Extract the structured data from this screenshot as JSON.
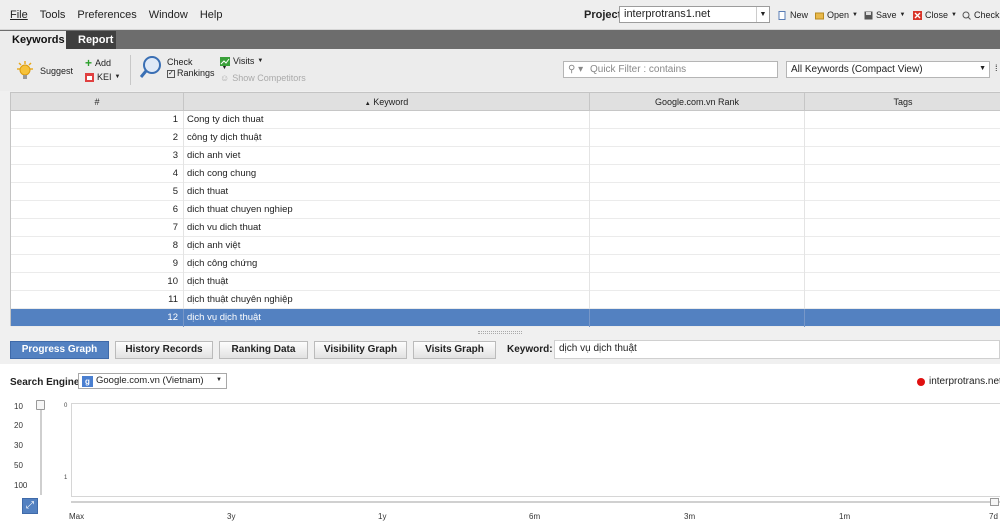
{
  "menu": {
    "items": [
      "File",
      "Tools",
      "Preferences",
      "Window",
      "Help"
    ],
    "project_label": "Project:",
    "project_value": "interprotrans1.net",
    "actions": {
      "new": "New",
      "open": "Open",
      "save": "Save",
      "close": "Close",
      "check": "Check"
    }
  },
  "tabs": {
    "keywords": "Keywords",
    "report": "Report"
  },
  "toolbar": {
    "suggest": "Suggest",
    "add": "Add",
    "kei": "KEI",
    "check": "Check",
    "rankings": "Rankings",
    "visits": "Visits",
    "show_competitors": "Show Competitors",
    "filter_placeholder": "Quick Filter : contains",
    "view_select": "All Keywords (Compact View)"
  },
  "table": {
    "headers": {
      "num": "#",
      "keyword": "Keyword",
      "rank": "Google.com.vn Rank",
      "tags": "Tags"
    },
    "sort_indicator": "▲",
    "rows": [
      {
        "num": "1",
        "keyword": "Cong ty dich thuat"
      },
      {
        "num": "2",
        "keyword": "công ty dịch thuật"
      },
      {
        "num": "3",
        "keyword": "dich anh viet"
      },
      {
        "num": "4",
        "keyword": "dich cong chung"
      },
      {
        "num": "5",
        "keyword": "dich thuat"
      },
      {
        "num": "6",
        "keyword": "dich thuat chuyen nghiep"
      },
      {
        "num": "7",
        "keyword": "dich vu dich thuat"
      },
      {
        "num": "8",
        "keyword": "dịch anh việt"
      },
      {
        "num": "9",
        "keyword": "dịch công chứng"
      },
      {
        "num": "10",
        "keyword": "dịch thuật"
      },
      {
        "num": "11",
        "keyword": "dịch thuật chuyên nghiệp"
      },
      {
        "num": "12",
        "keyword": "dịch vụ dịch thuật"
      }
    ],
    "selected_row": 12
  },
  "bottom_tabs": [
    "Progress Graph",
    "History Records",
    "Ranking Data",
    "Visibility Graph",
    "Visits Graph"
  ],
  "keyword_label": "Keyword:",
  "keyword_value": "dịch vụ dịch thuật",
  "graph": {
    "search_engine_label": "Search Engine:",
    "search_engine_value": "Google.com.vn (Vietnam)",
    "legend": "interprotrans.net/",
    "legend_color": "#e01010",
    "scale_levels": [
      "10",
      "20",
      "30",
      "50",
      "100"
    ],
    "y_ticks": [
      "0",
      "1"
    ],
    "x_labels": [
      "Max",
      "3y",
      "1y",
      "6m",
      "3m",
      "1m",
      "7d"
    ]
  },
  "colors": {
    "selection": "#5381c1",
    "tab_bar": "#6d6d6d"
  }
}
